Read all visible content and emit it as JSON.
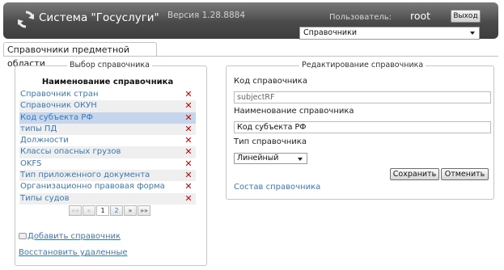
{
  "header": {
    "app_title": "Система \"Госуслуги\"",
    "version": "Версия 1.28.8884",
    "user_label": "Пользователь:",
    "user_name": "root",
    "logout_label": "Выход",
    "section_select": {
      "value": "Справочники"
    }
  },
  "tabs": [
    {
      "label": "Справочники предметной области",
      "active": true
    }
  ],
  "left_panel": {
    "legend": "Выбор справочника",
    "table": {
      "header": "Наименование справочника",
      "rows": [
        {
          "name": "Справочник стран"
        },
        {
          "name": "Справочник ОКУН"
        },
        {
          "name": "Код субъекта РФ",
          "selected": true
        },
        {
          "name": "типы ПД"
        },
        {
          "name": "Должности"
        },
        {
          "name": "Классы опасных грузов"
        },
        {
          "name": "OKFS"
        },
        {
          "name": "Тип приложенного документа"
        },
        {
          "name": "Организационно правовая форма"
        },
        {
          "name": "Типы судов"
        }
      ]
    },
    "pager": {
      "first": "««",
      "prev": "«",
      "pages": [
        "1",
        "2"
      ],
      "current_page": "1",
      "next": "»",
      "last": "»»"
    },
    "add_link": "Добавить справочник",
    "restore_link": "Восстановить удаленные"
  },
  "right_panel": {
    "legend": "Редактирование справочника",
    "code_label": "Код справочника",
    "code_value": "subjectRF",
    "name_label": "Наименование справочника",
    "name_value": "Код субъекта РФ",
    "type_label": "Тип справочника",
    "type_value": "Линейный",
    "save_label": "Сохранить",
    "cancel_label": "Отменить",
    "composition_link": "Состав справочника"
  },
  "colors": {
    "header_bg": "#4a4a4a",
    "link": "#3a78b5",
    "selected_row": "#c5d6ec",
    "delete_icon": "#c00000"
  },
  "icons": {
    "logo": "refresh-arrows-icon",
    "delete": "delete-x-icon",
    "add": "add-document-icon"
  }
}
